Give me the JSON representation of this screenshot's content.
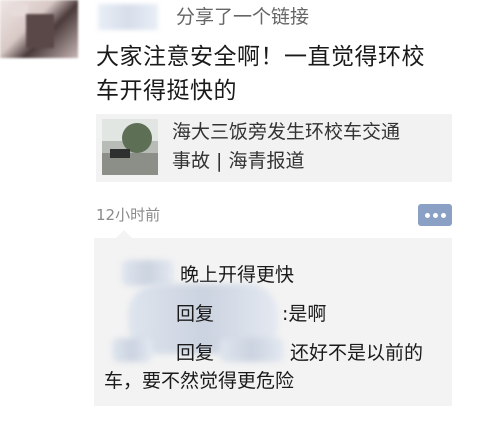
{
  "moment": {
    "share_label": "分享了一个链接",
    "text_line1": "大家注意安全啊！一直觉得环校",
    "text_line2": "车开得挺快的",
    "link": {
      "title_line1": "海大三饭旁发生环校车交通",
      "title_line2": "事故 | 海青报道"
    },
    "timestamp": "12小时前",
    "comment_icon": "more-dots-icon"
  },
  "comments": {
    "c1_text": "晚上开得更快",
    "c2_prefix": "回复",
    "c2_text": ":是啊",
    "c3_prefix": "回复",
    "c3_text": "还好不是以前的",
    "c3_line2": "车，要不然觉得更危险"
  },
  "colors": {
    "accent": "#8aa0c4",
    "card_bg": "#f2f2f2",
    "muted": "#8a8a8a"
  }
}
